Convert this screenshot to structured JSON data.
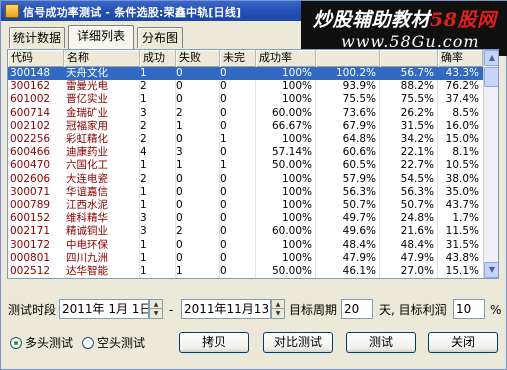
{
  "window": {
    "title": "信号成功率测试 - 条件选股:荣鑫中轨[日线]"
  },
  "watermark": {
    "line1_prefix": "炒股辅助教材",
    "line1_accent": "58股网",
    "line2": "www.58Gu.com"
  },
  "tabs": [
    {
      "label": "统计数据"
    },
    {
      "label": "详细列表"
    },
    {
      "label": "分布图"
    }
  ],
  "grid": {
    "headers": [
      "代码",
      "名称",
      "成功",
      "失败",
      "未完",
      "成功率",
      "",
      "",
      "",
      "确率"
    ],
    "rows": [
      [
        "300148",
        "天舟文化",
        "1",
        "0",
        "0",
        "100%",
        "100.2%",
        "56.7%",
        "43.3%"
      ],
      [
        "300162",
        "雷曼光电",
        "2",
        "0",
        "0",
        "100%",
        "93.9%",
        "88.2%",
        "76.2%"
      ],
      [
        "601002",
        "晋亿实业",
        "1",
        "0",
        "0",
        "100%",
        "75.5%",
        "75.5%",
        "37.4%"
      ],
      [
        "600714",
        "金瑞矿业",
        "3",
        "2",
        "0",
        "60.00%",
        "73.6%",
        "26.2%",
        "8.5%"
      ],
      [
        "002102",
        "冠福家用",
        "2",
        "1",
        "0",
        "66.67%",
        "67.9%",
        "31.5%",
        "16.0%"
      ],
      [
        "002256",
        "彩虹精化",
        "2",
        "0",
        "1",
        "100%",
        "64.8%",
        "34.2%",
        "15.0%"
      ],
      [
        "600466",
        "迪康药业",
        "4",
        "3",
        "0",
        "57.14%",
        "60.6%",
        "22.1%",
        "8.1%"
      ],
      [
        "600470",
        "六国化工",
        "1",
        "1",
        "1",
        "50.00%",
        "60.5%",
        "22.7%",
        "10.5%"
      ],
      [
        "002606",
        "大连电瓷",
        "2",
        "0",
        "0",
        "100%",
        "57.9%",
        "54.5%",
        "38.0%"
      ],
      [
        "300071",
        "华谊嘉信",
        "1",
        "0",
        "0",
        "100%",
        "56.3%",
        "56.3%",
        "35.0%"
      ],
      [
        "000789",
        "江西水泥",
        "1",
        "0",
        "0",
        "100%",
        "50.7%",
        "50.7%",
        "43.7%"
      ],
      [
        "600152",
        "维科精华",
        "3",
        "0",
        "0",
        "100%",
        "49.7%",
        "24.8%",
        "1.7%"
      ],
      [
        "002171",
        "精诚铜业",
        "3",
        "2",
        "0",
        "60.00%",
        "49.6%",
        "21.6%",
        "11.5%"
      ],
      [
        "300172",
        "中电环保",
        "1",
        "0",
        "0",
        "100%",
        "48.4%",
        "48.4%",
        "31.5%"
      ],
      [
        "000801",
        "四川九洲",
        "1",
        "0",
        "0",
        "100%",
        "47.9%",
        "47.9%",
        "43.8%"
      ],
      [
        "002512",
        "达华智能",
        "1",
        "1",
        "0",
        "50.00%",
        "46.1%",
        "27.0%",
        "15.1%"
      ]
    ],
    "selected_row": 0
  },
  "controls": {
    "test_period_label": "测试时段",
    "start_date": "2011年 1月 1日",
    "dash": "-",
    "end_date": "2011年11月13日",
    "target_period_label": "目标周期",
    "target_period_value": "20",
    "target_profit_label": "天, 目标利润",
    "target_profit_value": "10",
    "percent_sign": "%",
    "radio_long": "多头测试",
    "radio_short": "空头测试",
    "long_selected": true,
    "buttons": {
      "copy": "拷贝",
      "compare": "对比测试",
      "test": "测试",
      "close": "关闭"
    }
  },
  "colors": {
    "selection": "#316ac5",
    "code_text": "#8b0000",
    "title_bar": "#2652b8"
  }
}
